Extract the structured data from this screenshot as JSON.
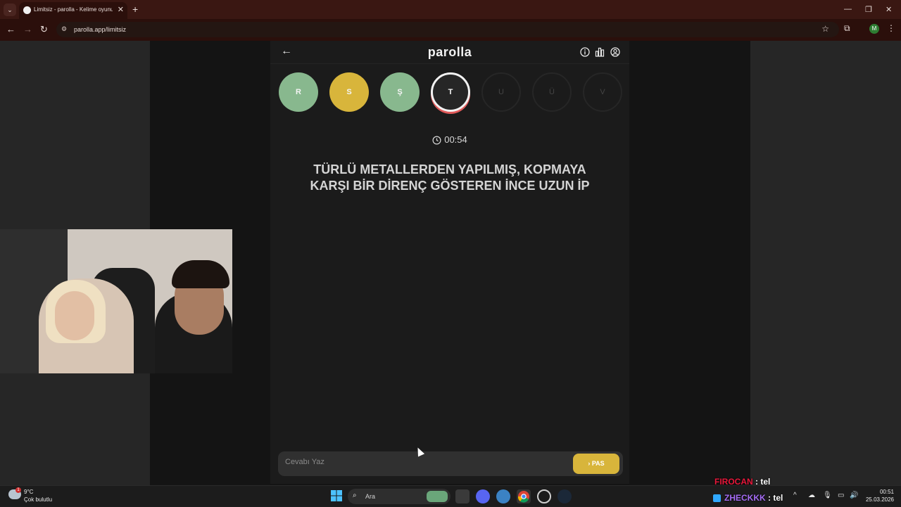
{
  "browser": {
    "tab_title": "Limitsiz - parolla - Kelime oyunu",
    "url": "parolla.app/limitsiz",
    "profile_initial": "M",
    "tab_list_glyph": "⌄",
    "close_glyph": "✕",
    "new_tab_glyph": "+",
    "minimize_glyph": "—",
    "maximize_glyph": "❐",
    "window_close_glyph": "✕",
    "back_glyph": "←",
    "forward_glyph": "→",
    "reload_glyph": "↻",
    "site_info_glyph": "⚙",
    "star_glyph": "☆",
    "extensions_glyph": "⧉",
    "menu_glyph": "⋮"
  },
  "game": {
    "logo": "parolla",
    "back_glyph": "←",
    "letters": [
      {
        "letter": "R",
        "state": "correct"
      },
      {
        "letter": "S",
        "state": "passed"
      },
      {
        "letter": "Ş",
        "state": "correct"
      },
      {
        "letter": "T",
        "state": "active"
      },
      {
        "letter": "U",
        "state": "pending"
      },
      {
        "letter": "Ü",
        "state": "pending"
      },
      {
        "letter": "V",
        "state": "pending"
      }
    ],
    "timer": "00:54",
    "question": "TÜRLÜ METALLERDEN YAPILMIŞ, KOPMAYA KARŞI BİR DİRENÇ GÖSTEREN İNCE UZUN İP",
    "answer_placeholder": "Cevabı Yaz",
    "pass_label": "› PAS",
    "colors": {
      "correct": "#88b88e",
      "passed": "#d8b53b",
      "active_ring": "#f2f2f2",
      "active_underline": "#e05a5a"
    }
  },
  "chat": [
    {
      "user": "FIROCAN",
      "message": " : tel"
    },
    {
      "user": "ZHECKKK",
      "message": " : tel"
    }
  ],
  "taskbar": {
    "weather_temp": "9°C",
    "weather_desc": "Çok bulutlu",
    "weather_badge": "1",
    "search_placeholder": "Ara",
    "search_glyph": "⌕",
    "time": "00:51",
    "date": "25.03.2026",
    "tray_up_glyph": "^",
    "tray_icons": [
      "☁",
      "🎙",
      "▭",
      "🔊"
    ]
  }
}
